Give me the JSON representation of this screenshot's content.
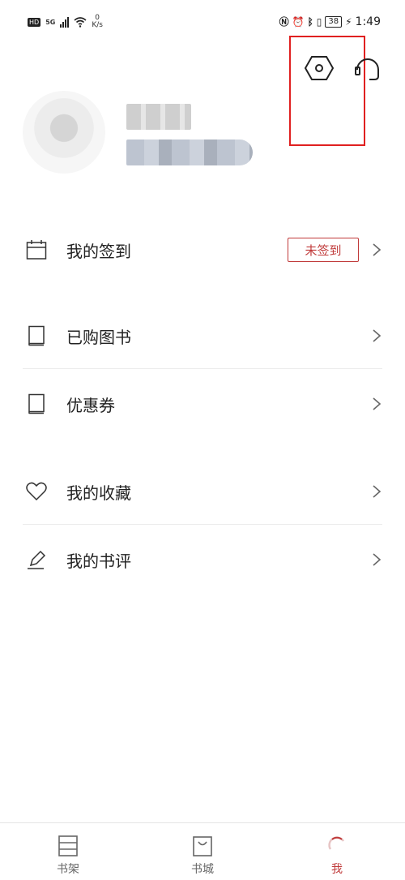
{
  "status_bar": {
    "hd": "HD",
    "network": "5G",
    "speed_value": "0",
    "speed_unit": "K/s",
    "nfc_icon": "nfc-icon",
    "alarm_icon": "alarm-icon",
    "bluetooth_icon": "bluetooth-icon",
    "vibrate_icon": "vibrate-icon",
    "battery": "38",
    "time": "1:49"
  },
  "header": {
    "settings_icon": "gear-icon",
    "service_icon": "headset-icon",
    "highlight_color": "#e02020"
  },
  "menu": {
    "checkin": {
      "label": "我的签到",
      "badge": "未签到",
      "icon": "calendar-icon"
    },
    "purchased": {
      "label": "已购图书",
      "icon": "book-icon"
    },
    "coupons": {
      "label": "优惠券",
      "icon": "book-icon"
    },
    "favorites": {
      "label": "我的收藏",
      "icon": "heart-icon"
    },
    "reviews": {
      "label": "我的书评",
      "icon": "pencil-icon"
    }
  },
  "bottom_nav": {
    "items": [
      {
        "label": "书架",
        "icon": "bookshelf-icon"
      },
      {
        "label": "书城",
        "icon": "bag-icon"
      },
      {
        "label": "我",
        "icon": "profile-icon"
      }
    ],
    "active_index": 2
  },
  "colors": {
    "accent": "#c03a3a",
    "text": "#222222",
    "divider": "#ececec"
  }
}
